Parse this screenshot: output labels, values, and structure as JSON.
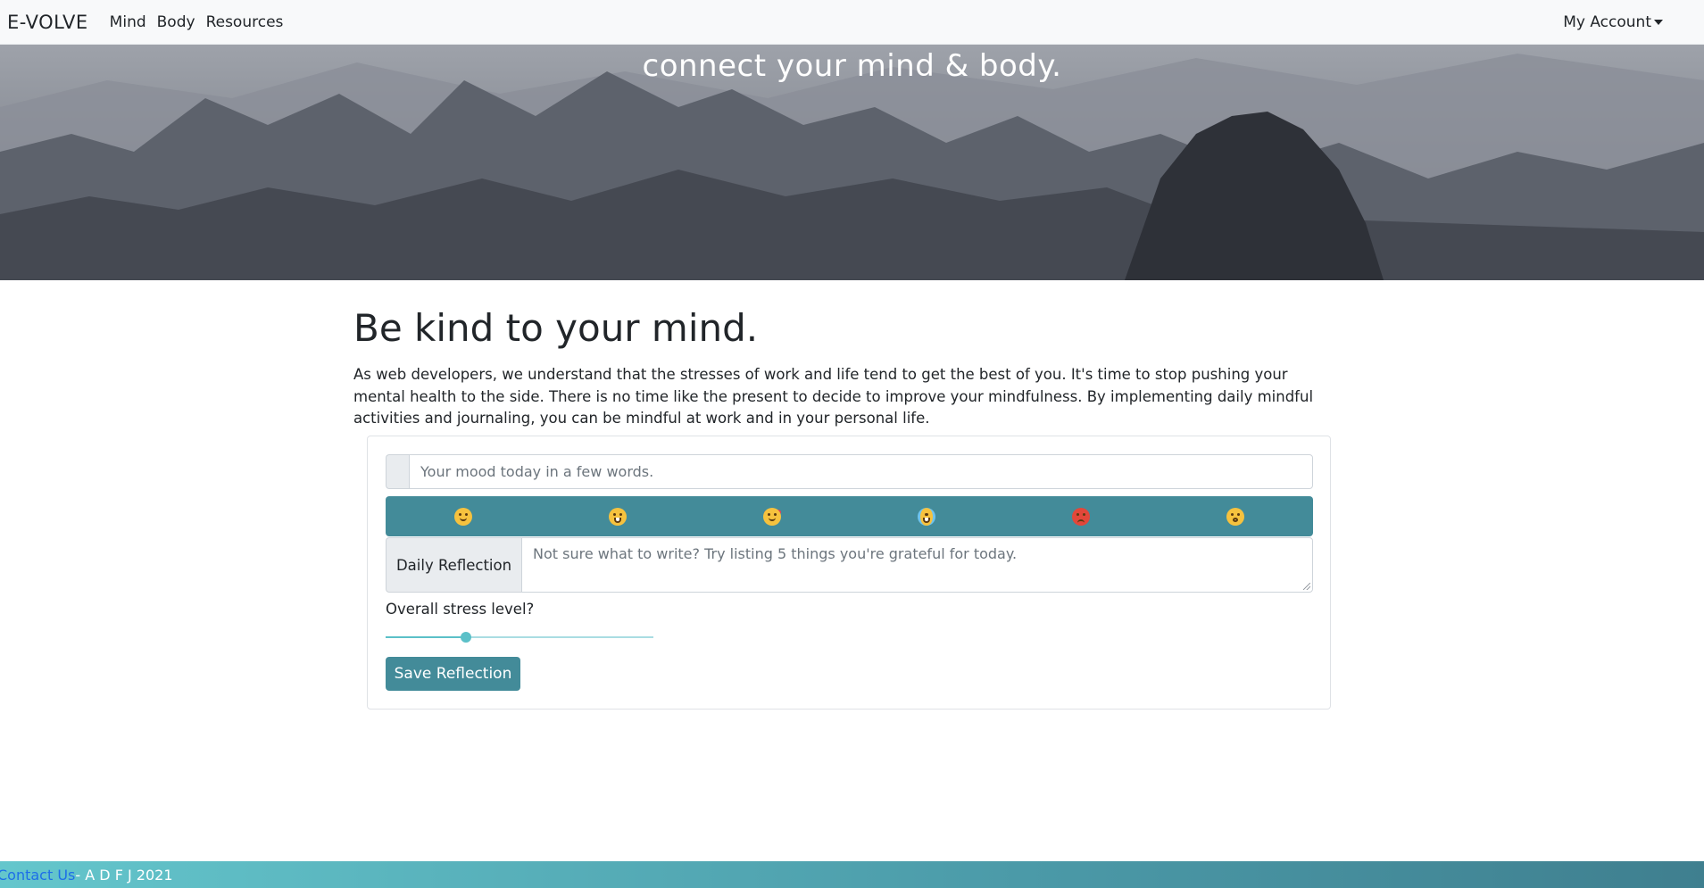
{
  "navbar": {
    "brand": "E-VOLVE",
    "links": [
      "Mind",
      "Body",
      "Resources"
    ],
    "account": "My Account"
  },
  "hero": {
    "text": "connect your mind & body."
  },
  "main": {
    "heading": "Be kind to your mind.",
    "lead": "As web developers, we understand that the stresses of work and life tend to get the best of you. It's time to stop pushing your mental health to the side. There is no time like the present to decide to improve your mindfulness. By implementing daily mindful activities and journaling, you can be mindful at work and in your personal life."
  },
  "form": {
    "mood_placeholder": "Your mood today in a few words.",
    "moods": [
      "relieved-face",
      "grinning-face",
      "smiling-face-with-hearts",
      "crying-laughing-face",
      "angry-face",
      "sleepy-face"
    ],
    "reflection_label": "Daily Reflection",
    "reflection_placeholder": "Not sure what to write? Try listing 5 things you're grateful for today.",
    "stress_label": "Overall stress level?",
    "stress_value": 0.3,
    "save_label": "Save Reflection"
  },
  "footer": {
    "contact_label": "Contact Us",
    "credit": " - A D F J 2021"
  },
  "colors": {
    "accent": "#438b99",
    "slider": "#5bc0c8",
    "footer_start": "#64c6cc",
    "footer_end": "#3f7f8f",
    "link": "#1e6fe8"
  }
}
